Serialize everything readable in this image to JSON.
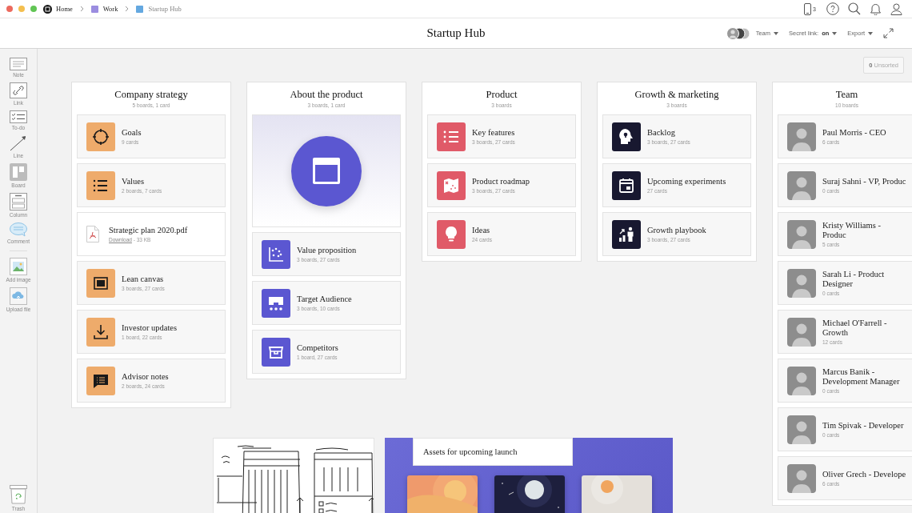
{
  "breadcrumbs": [
    {
      "label": "Home"
    },
    {
      "label": "Work"
    },
    {
      "label": "Startup Hub"
    }
  ],
  "device_count": "3",
  "title": "Startup Hub",
  "header_actions": {
    "team": "Team",
    "secret_link": "Secret link: **on**",
    "export": "Export"
  },
  "unsorted": "**0** Unsorted",
  "tools": [
    "Note",
    "Link",
    "To-do",
    "Line",
    "Board",
    "Column",
    "Comment",
    "Add image",
    "Upload file"
  ],
  "trash": "Trash",
  "columns": [
    {
      "title": "Company strategy",
      "subtitle": "5 boards, 1 card",
      "color": "#eeab6b",
      "items": [
        {
          "kind": "board",
          "title": "Goals",
          "meta": "9 cards"
        },
        {
          "kind": "board",
          "title": "Values",
          "meta": "2 boards, 7 cards"
        },
        {
          "kind": "file",
          "title": "Strategic plan 2020.pdf",
          "link": "Download",
          "meta": " - 33 KB"
        },
        {
          "kind": "board",
          "title": "Lean canvas",
          "meta": "3 boards, 27 cards"
        },
        {
          "kind": "board",
          "title": "Investor updates",
          "meta": "1 board, 22 cards"
        },
        {
          "kind": "board",
          "title": "Advisor notes",
          "meta": "2 boards, 24 cards"
        }
      ]
    },
    {
      "title": "About the product",
      "subtitle": "3 boards, 1 card",
      "color": "#5b57d1",
      "items": [
        {
          "kind": "cover"
        },
        {
          "kind": "board",
          "title": "Value proposition",
          "meta": "3 boards, 27 cards"
        },
        {
          "kind": "board",
          "title": "Target Audience",
          "meta": "3 boards, 10 cards"
        },
        {
          "kind": "board",
          "title": "Competitors",
          "meta": "1 board, 27 cards"
        }
      ]
    },
    {
      "title": "Product",
      "subtitle": "3 boards",
      "color": "#e05a68",
      "items": [
        {
          "kind": "board",
          "title": "Key features",
          "meta": "3 boards, 27 cards"
        },
        {
          "kind": "board",
          "title": "Product roadmap",
          "meta": "3 boards, 27 cards"
        },
        {
          "kind": "board",
          "title": "Ideas",
          "meta": "24 cards"
        }
      ]
    },
    {
      "title": "Growth & marketing",
      "subtitle": "3 boards",
      "color": "#181830",
      "items": [
        {
          "kind": "board",
          "title": "Backlog",
          "meta": "3 boards, 27 cards"
        },
        {
          "kind": "board",
          "title": "Upcoming experiments",
          "meta": "27 cards"
        },
        {
          "kind": "board",
          "title": "Growth playbook",
          "meta": "3 boards, 27 cards"
        }
      ]
    },
    {
      "title": "Team",
      "subtitle": "10 boards",
      "items": [
        {
          "kind": "person",
          "title": "Paul Morris - CEO",
          "meta": "6 cards"
        },
        {
          "kind": "person",
          "title": "Suraj Sahni - VP, Produc",
          "meta": "0 cards"
        },
        {
          "kind": "person",
          "title": "Kristy Williams - Produc",
          "meta": "5 cards"
        },
        {
          "kind": "person",
          "title": "Sarah Li - Product Designer",
          "meta": "0 cards"
        },
        {
          "kind": "person",
          "title": "Michael O'Farrell - Growth",
          "meta": "12 cards"
        },
        {
          "kind": "person",
          "title": "Marcus Banik - Development Manager",
          "meta": "0 cards"
        },
        {
          "kind": "person",
          "title": "Tim Spivak - Developer",
          "meta": "0 cards"
        },
        {
          "kind": "person",
          "title": "Oliver Grech - Develope",
          "meta": "6 cards"
        }
      ]
    }
  ],
  "assets": {
    "label": "Assets for upcoming launch"
  }
}
